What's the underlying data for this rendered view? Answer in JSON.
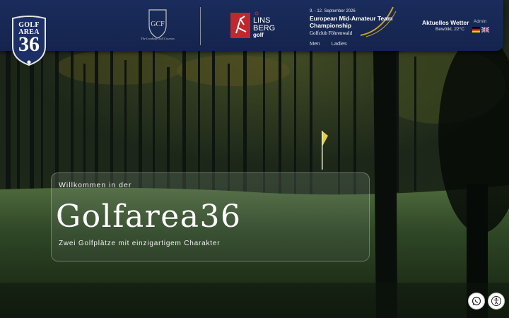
{
  "brand": {
    "logo_line1": "GOLF",
    "logo_line2": "AREA",
    "logo_number": "36"
  },
  "partners": {
    "club_crest_letters": "GCF",
    "club_tagline": "The Leading Golf Courses",
    "linsberg_line1": "LINS",
    "linsberg_line2": "BERG",
    "linsberg_line3": "golf"
  },
  "event": {
    "date": "9. - 12. September 2026",
    "title": "European Mid-Amateur Team Championship",
    "venue": "Golfclub Föhrenwald",
    "tabs": [
      {
        "label": "Men"
      },
      {
        "label": "Ladies"
      }
    ]
  },
  "weather": {
    "title": "Aktuelles Wetter",
    "status": "Bewölkt, 22°C"
  },
  "utility": {
    "admin_label": "Admin",
    "languages": [
      "de",
      "en"
    ]
  },
  "hero": {
    "intro": "Willkommen in der",
    "title": "Golfarea36",
    "subtitle": "Zwei Golfplätze mit einzigartigem Charakter"
  },
  "colors": {
    "header_bg": "#1a2c5c",
    "accent_red": "#c0282d",
    "event_gold": "#c9a227"
  },
  "icons": {
    "whatsapp": "whatsapp-icon",
    "accessibility": "accessibility-icon"
  }
}
